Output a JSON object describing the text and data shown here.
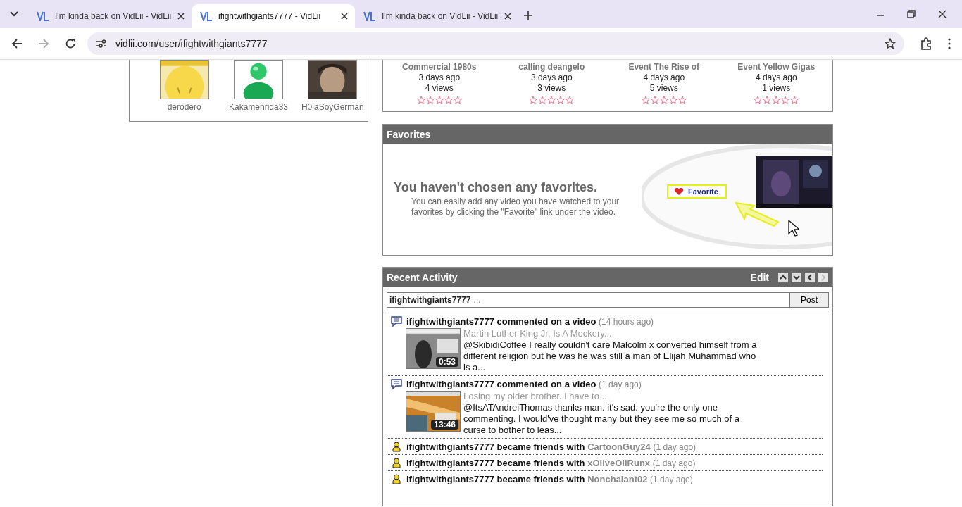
{
  "browser": {
    "tabs": [
      {
        "title": "I'm kinda back on VidLii - VidLii",
        "selected": false
      },
      {
        "title": "ifightwithgiants7777 - VidLii",
        "selected": true
      },
      {
        "title": "I'm kinda back on VidLii - VidLii",
        "selected": false
      }
    ],
    "url": "vidlii.com/user/ifightwithgiants7777"
  },
  "friends": [
    {
      "name": "derodero"
    },
    {
      "name": "Kakamenrida33"
    },
    {
      "name": "H0laSoyGerman"
    }
  ],
  "videos": [
    {
      "title": "Commercial 1980s",
      "age": "3 days ago",
      "views": "4 views",
      "stars": 0
    },
    {
      "title": "calling deangelo",
      "age": "3 days ago",
      "views": "3 views",
      "stars": 0
    },
    {
      "title": "Event The Rise of",
      "age": "4 days ago",
      "views": "5 views",
      "stars": 0
    },
    {
      "title": "Event Yellow Gigas",
      "age": "4 days ago",
      "views": "1 views",
      "stars": 0
    }
  ],
  "favorites": {
    "title": "Favorites",
    "heading": "You haven't chosen any favorites.",
    "text": "You can easily add any video you have watched to your favorites by clicking the \"Favorite\" link under the video.",
    "illustration_label": "Favorite"
  },
  "activity": {
    "title": "Recent Activity",
    "edit": "Edit",
    "status_user": "ifightwithgiants7777",
    "placeholder": "...",
    "post": "Post",
    "items": [
      {
        "kind": "comment",
        "user": "ifightwithgiants7777",
        "action": "commented on a video",
        "time": "(14 hours ago)",
        "video": "Martin Luther King Jr. Is A Mockery...",
        "duration": "0:53",
        "text": "@SkibidiCoffee I really couldn't care Malcolm x converted himself from a different religion but he was he was still a man of Elijah Muhammad who is a..."
      },
      {
        "kind": "comment",
        "user": "ifightwithgiants7777",
        "action": "commented on a video",
        "time": "(1 day ago)",
        "video": "Losing my older brother. I have to ...",
        "duration": "13:46",
        "text": "@ItsATAndreiThomas thanks man. it's sad. you're the only one commenting. I would've thought many but they see me so much of a curse to bother to leas..."
      },
      {
        "kind": "friend",
        "user": "ifightwithgiants7777",
        "action": "became friends with",
        "friend": "CartoonGuy24",
        "time": "(1 day ago)"
      },
      {
        "kind": "friend",
        "user": "ifightwithgiants7777",
        "action": "became friends with",
        "friend": "xOliveOilRunx",
        "time": "(1 day ago)"
      },
      {
        "kind": "friend",
        "user": "ifightwithgiants7777",
        "action": "became friends with",
        "friend": "Nonchalant02",
        "time": "(1 day ago)"
      }
    ]
  }
}
